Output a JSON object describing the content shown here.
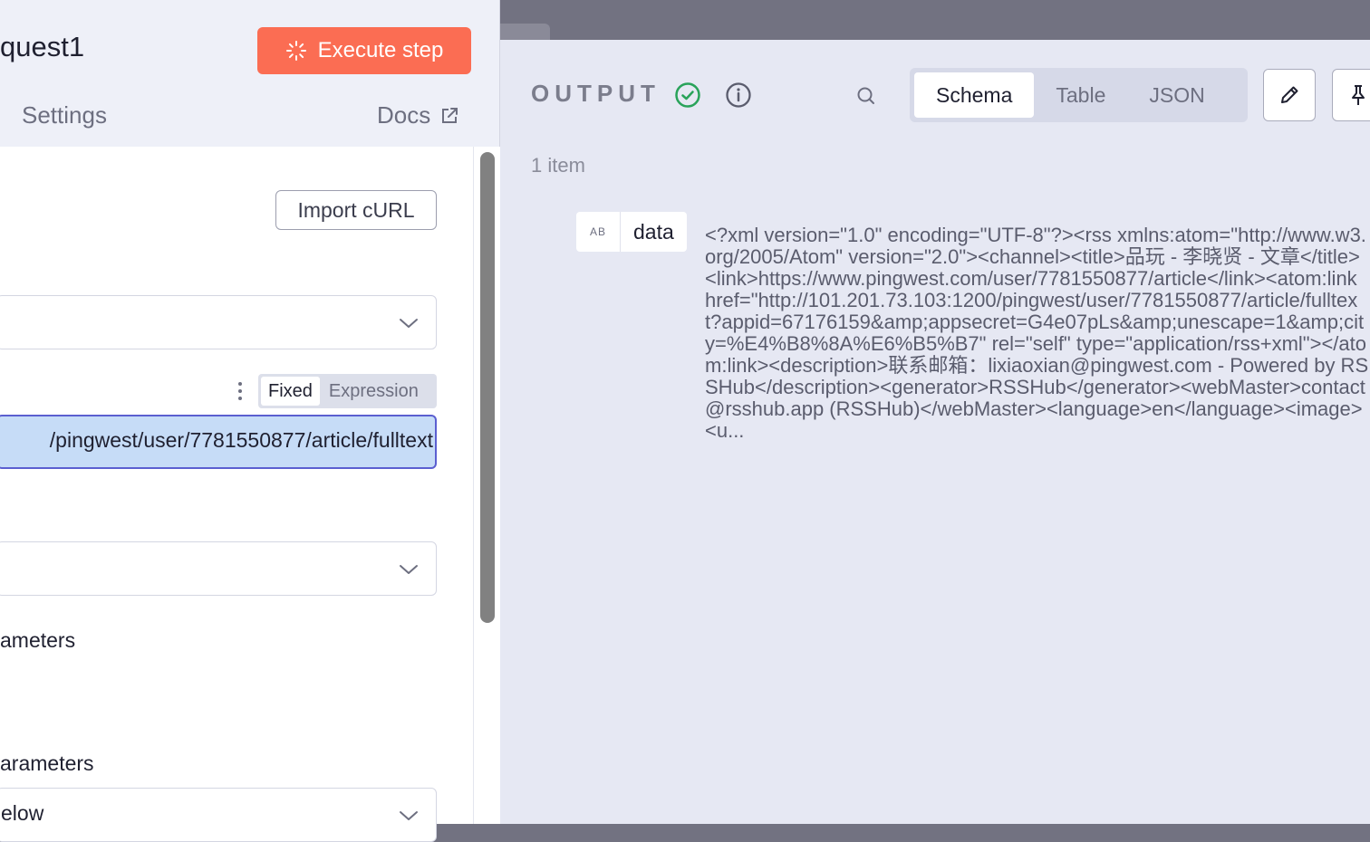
{
  "left": {
    "node_title": "quest1",
    "execute_label": "Execute step",
    "tabs": {
      "settings": "Settings",
      "docs": "Docs"
    },
    "import_curl_label": "Import cURL",
    "url_mode": {
      "fixed": "Fixed",
      "expression": "Expression"
    },
    "url_value": "/pingwest/user/7781550877/article/fulltext",
    "params": [
      {
        "label": "ameters"
      },
      {
        "label": "arameters"
      }
    ],
    "bottom_select_value": "elow"
  },
  "output": {
    "label": "OUTPUT",
    "item_count": "1 item",
    "views": [
      "Schema",
      "Table",
      "JSON"
    ],
    "active_view": "Schema",
    "field": {
      "type_badge": "AB",
      "key": "data",
      "value": "<?xml version=\"1.0\" encoding=\"UTF-8\"?><rss xmlns:atom=\"http://www.w3.org/2005/Atom\" version=\"2.0\"><channel><title>品玩 - 李晓贤 - 文章</title><link>https://www.pingwest.com/user/7781550877/article</link><atom:link href=\"http://101.201.73.103:1200/pingwest/user/7781550877/article/fulltext?appid=67176159&amp;appsecret=G4e07pLs&amp;unescape=1&amp;city=%E4%B8%8A%E6%B5%B7\" rel=\"self\" type=\"application/rss+xml\"></atom:link><description>联系邮箱：lixiaoxian@pingwest.com - Powered by RSSHub</description><generator>RSSHub</generator><webMaster>contact@rsshub.app (RSSHub)</webMaster><language>en</language><image><u..."
    }
  },
  "colors": {
    "accent": "#fb6d53",
    "success": "#29a35a",
    "focus": "#5b5fd0"
  }
}
